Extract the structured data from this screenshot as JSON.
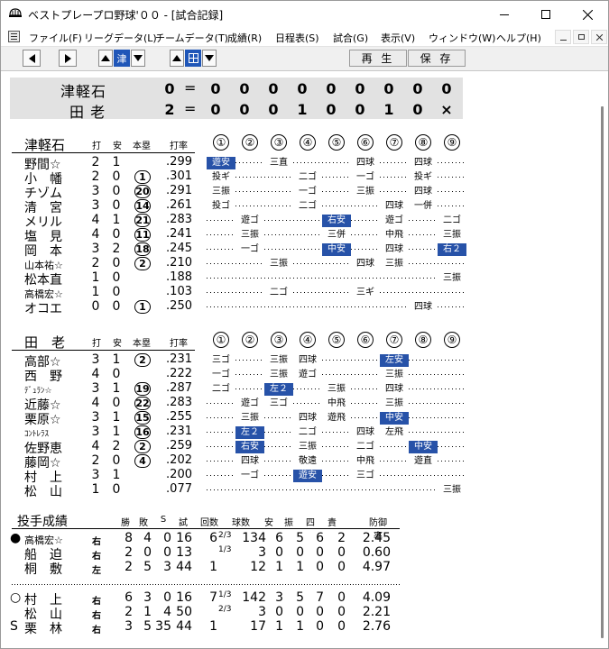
{
  "window": {
    "title": "ベストプレープロ野球'００ - [試合記録]"
  },
  "menu": [
    "ファイル(F)",
    "リーグデータ(L)",
    "チームデータ(T)",
    "成績(R)",
    "日程表(S)",
    "試合(G)",
    "表示(V)",
    "ウィンドウ(W)",
    "ヘルプ(H)"
  ],
  "toolbar": {
    "team_label": "津",
    "play_label": "再 生",
    "save_label": "保 存"
  },
  "score": {
    "away": {
      "name": "津軽石",
      "total": "0",
      "innings": [
        "0",
        "0",
        "0",
        "0",
        "0",
        "0",
        "0",
        "0",
        "0"
      ]
    },
    "home": {
      "name": "田 老",
      "total": "2",
      "innings": [
        "0",
        "0",
        "0",
        "1",
        "0",
        "0",
        "1",
        "0",
        "×"
      ]
    },
    "eq": "="
  },
  "headers": {
    "ab": "打",
    "hit": "安",
    "hr": "本塁",
    "avg": "打率",
    "innings": [
      "①",
      "②",
      "③",
      "④",
      "⑤",
      "⑥",
      "⑦",
      "⑧",
      "⑨"
    ]
  },
  "away_team": {
    "name": "津軽石",
    "batters": [
      {
        "name": "野間☆",
        "ab": "2",
        "hit": "1",
        "hr": "",
        "avg": ".299",
        "size": "n",
        "inn": [
          {
            "t": "遊安",
            "h": true
          },
          {
            "t": ""
          },
          {
            "t": "三直"
          },
          {
            "t": ""
          },
          {
            "t": ""
          },
          {
            "t": "四球"
          },
          {
            "t": ""
          },
          {
            "t": "四球"
          },
          {
            "t": ""
          }
        ]
      },
      {
        "name": "小　幡",
        "ab": "2",
        "hit": "0",
        "hr": "1",
        "avg": ".301",
        "size": "n",
        "inn": [
          {
            "t": "投ギ"
          },
          {
            "t": ""
          },
          {
            "t": ""
          },
          {
            "t": "二ゴ"
          },
          {
            "t": ""
          },
          {
            "t": "一ゴ"
          },
          {
            "t": ""
          },
          {
            "t": "投ギ"
          },
          {
            "t": ""
          }
        ]
      },
      {
        "name": "チゾム",
        "ab": "3",
        "hit": "0",
        "hr": "20",
        "avg": ".291",
        "size": "n",
        "inn": [
          {
            "t": "三振"
          },
          {
            "t": ""
          },
          {
            "t": ""
          },
          {
            "t": "一ゴ"
          },
          {
            "t": ""
          },
          {
            "t": "三振"
          },
          {
            "t": ""
          },
          {
            "t": "四球"
          },
          {
            "t": ""
          }
        ]
      },
      {
        "name": "清　宮",
        "ab": "3",
        "hit": "0",
        "hr": "14",
        "avg": ".261",
        "size": "n",
        "inn": [
          {
            "t": "投ゴ"
          },
          {
            "t": ""
          },
          {
            "t": ""
          },
          {
            "t": "二ゴ"
          },
          {
            "t": ""
          },
          {
            "t": ""
          },
          {
            "t": "四球"
          },
          {
            "t": "一併"
          },
          {
            "t": ""
          }
        ]
      },
      {
        "name": "メリル",
        "ab": "4",
        "hit": "1",
        "hr": "21",
        "avg": ".283",
        "size": "n",
        "inn": [
          {
            "t": ""
          },
          {
            "t": "遊ゴ"
          },
          {
            "t": ""
          },
          {
            "t": ""
          },
          {
            "t": "右安",
            "h": true
          },
          {
            "t": ""
          },
          {
            "t": "遊ゴ"
          },
          {
            "t": ""
          },
          {
            "t": "二ゴ"
          }
        ]
      },
      {
        "name": "塩　見",
        "ab": "4",
        "hit": "0",
        "hr": "11",
        "avg": ".241",
        "size": "n",
        "inn": [
          {
            "t": ""
          },
          {
            "t": "三振"
          },
          {
            "t": ""
          },
          {
            "t": ""
          },
          {
            "t": "三併"
          },
          {
            "t": ""
          },
          {
            "t": "中飛"
          },
          {
            "t": ""
          },
          {
            "t": "三振"
          }
        ]
      },
      {
        "name": "岡　本",
        "ab": "3",
        "hit": "2",
        "hr": "18",
        "avg": ".245",
        "size": "n",
        "inn": [
          {
            "t": ""
          },
          {
            "t": "一ゴ"
          },
          {
            "t": ""
          },
          {
            "t": ""
          },
          {
            "t": "中安",
            "h": true
          },
          {
            "t": ""
          },
          {
            "t": "四球"
          },
          {
            "t": ""
          },
          {
            "t": "右２",
            "h": true
          }
        ]
      },
      {
        "name": "山本祐☆",
        "ab": "2",
        "hit": "0",
        "hr": "2",
        "avg": ".210",
        "size": "s",
        "inn": [
          {
            "t": ""
          },
          {
            "t": ""
          },
          {
            "t": "三振"
          },
          {
            "t": ""
          },
          {
            "t": ""
          },
          {
            "t": "四球"
          },
          {
            "t": "三振"
          },
          {
            "t": ""
          },
          {
            "t": ""
          }
        ]
      },
      {
        "name": "松本直",
        "ab": "1",
        "hit": "0",
        "hr": "",
        "avg": ".188",
        "size": "n",
        "inn": [
          {
            "t": ""
          },
          {
            "t": ""
          },
          {
            "t": ""
          },
          {
            "t": ""
          },
          {
            "t": ""
          },
          {
            "t": ""
          },
          {
            "t": ""
          },
          {
            "t": ""
          },
          {
            "t": "三振"
          }
        ]
      },
      {
        "name": "高橋宏☆",
        "ab": "1",
        "hit": "0",
        "hr": "",
        "avg": ".103",
        "size": "s",
        "inn": [
          {
            "t": ""
          },
          {
            "t": ""
          },
          {
            "t": "二ゴ"
          },
          {
            "t": ""
          },
          {
            "t": ""
          },
          {
            "t": "三ギ"
          },
          {
            "t": ""
          },
          {
            "t": ""
          },
          {
            "t": ""
          }
        ]
      },
      {
        "name": "オコエ",
        "ab": "0",
        "hit": "0",
        "hr": "1",
        "avg": ".250",
        "size": "n",
        "inn": [
          {
            "t": "-"
          },
          {
            "t": "-"
          },
          {
            "t": "-"
          },
          {
            "t": "-"
          },
          {
            "t": "-"
          },
          {
            "t": "-"
          },
          {
            "t": "-"
          },
          {
            "t": "四球"
          },
          {
            "t": "-"
          }
        ]
      }
    ]
  },
  "home_team": {
    "name": "田　老",
    "batters": [
      {
        "name": "高部☆",
        "ab": "3",
        "hit": "1",
        "hr": "2",
        "avg": ".231",
        "size": "n",
        "inn": [
          {
            "t": "三ゴ"
          },
          {
            "t": ""
          },
          {
            "t": "三振"
          },
          {
            "t": "四球"
          },
          {
            "t": ""
          },
          {
            "t": ""
          },
          {
            "t": "左安",
            "h": true
          },
          {
            "t": ""
          },
          {
            "t": ""
          }
        ]
      },
      {
        "name": "西　野",
        "ab": "4",
        "hit": "0",
        "hr": "",
        "avg": ".222",
        "size": "n",
        "inn": [
          {
            "t": "一ゴ"
          },
          {
            "t": ""
          },
          {
            "t": "三振"
          },
          {
            "t": "遊ゴ"
          },
          {
            "t": ""
          },
          {
            "t": ""
          },
          {
            "t": "三振"
          },
          {
            "t": ""
          },
          {
            "t": ""
          }
        ]
      },
      {
        "name": "ﾃﾞｭﾗﾝ☆",
        "ab": "3",
        "hit": "1",
        "hr": "19",
        "avg": ".287",
        "size": "t",
        "inn": [
          {
            "t": "二ゴ"
          },
          {
            "t": ""
          },
          {
            "t": "左２",
            "h": true
          },
          {
            "t": ""
          },
          {
            "t": "三振"
          },
          {
            "t": ""
          },
          {
            "t": "四球"
          },
          {
            "t": ""
          },
          {
            "t": ""
          }
        ]
      },
      {
        "name": "近藤☆",
        "ab": "4",
        "hit": "0",
        "hr": "22",
        "avg": ".283",
        "size": "n",
        "inn": [
          {
            "t": ""
          },
          {
            "t": "遊ゴ"
          },
          {
            "t": "三ゴ"
          },
          {
            "t": ""
          },
          {
            "t": "中飛"
          },
          {
            "t": ""
          },
          {
            "t": "三振"
          },
          {
            "t": ""
          },
          {
            "t": ""
          }
        ]
      },
      {
        "name": "栗原☆",
        "ab": "3",
        "hit": "1",
        "hr": "15",
        "avg": ".255",
        "size": "n",
        "inn": [
          {
            "t": ""
          },
          {
            "t": "三振"
          },
          {
            "t": ""
          },
          {
            "t": "四球"
          },
          {
            "t": "遊飛"
          },
          {
            "t": ""
          },
          {
            "t": "中安",
            "h": true
          },
          {
            "t": ""
          },
          {
            "t": ""
          }
        ]
      },
      {
        "name": "ｺﾝﾄﾚﾗｽ",
        "ab": "3",
        "hit": "1",
        "hr": "16",
        "avg": ".231",
        "size": "t",
        "inn": [
          {
            "t": ""
          },
          {
            "t": "左２",
            "h": true
          },
          {
            "t": ""
          },
          {
            "t": "二ゴ"
          },
          {
            "t": ""
          },
          {
            "t": "四球"
          },
          {
            "t": "左飛"
          },
          {
            "t": ""
          },
          {
            "t": ""
          }
        ]
      },
      {
        "name": "佐野恵",
        "ab": "4",
        "hit": "2",
        "hr": "2",
        "avg": ".259",
        "size": "n",
        "inn": [
          {
            "t": ""
          },
          {
            "t": "右安",
            "h": true
          },
          {
            "t": ""
          },
          {
            "t": "三振"
          },
          {
            "t": ""
          },
          {
            "t": "二ゴ"
          },
          {
            "t": ""
          },
          {
            "t": "中安",
            "h": true
          },
          {
            "t": ""
          }
        ]
      },
      {
        "name": "藤岡☆",
        "ab": "2",
        "hit": "0",
        "hr": "4",
        "avg": ".202",
        "size": "n",
        "inn": [
          {
            "t": ""
          },
          {
            "t": "四球"
          },
          {
            "t": ""
          },
          {
            "t": "敬遠"
          },
          {
            "t": ""
          },
          {
            "t": "中飛"
          },
          {
            "t": ""
          },
          {
            "t": "遊直"
          },
          {
            "t": ""
          }
        ]
      },
      {
        "name": "村　上",
        "ab": "3",
        "hit": "1",
        "hr": "",
        "avg": ".200",
        "size": "n",
        "inn": [
          {
            "t": ""
          },
          {
            "t": "一ゴ"
          },
          {
            "t": ""
          },
          {
            "t": "遊安",
            "h": true
          },
          {
            "t": ""
          },
          {
            "t": "三ゴ"
          },
          {
            "t": ""
          },
          {
            "t": ""
          },
          {
            "t": ""
          }
        ]
      },
      {
        "name": "松　山",
        "ab": "1",
        "hit": "0",
        "hr": "",
        "avg": ".077",
        "size": "n",
        "inn": [
          {
            "t": "-"
          },
          {
            "t": "-"
          },
          {
            "t": "-"
          },
          {
            "t": "-"
          },
          {
            "t": "-"
          },
          {
            "t": "-"
          },
          {
            "t": "-"
          },
          {
            "t": "-"
          },
          {
            "t": "三振"
          }
        ]
      }
    ]
  },
  "pitching": {
    "title": "投手成績",
    "headers": [
      "勝",
      "敗",
      "S",
      "試",
      "回数",
      "球数",
      "安",
      "振",
      "四",
      "責",
      "防御率"
    ],
    "away": [
      {
        "mark": "●",
        "name": "高橋宏☆",
        "hand": "右",
        "w": "8",
        "l": "4",
        "s": "0",
        "g": "16",
        "ip": "6",
        "ipf": "2/3",
        "np": "134",
        "h": "6",
        "k": "5",
        "bb": "6",
        "er": "2",
        "era": "2.45",
        "small": true
      },
      {
        "mark": "",
        "name": "船　迫",
        "hand": "右",
        "w": "2",
        "l": "0",
        "s": "0",
        "g": "13",
        "ip": "",
        "ipf": "1/3",
        "np": "3",
        "h": "0",
        "k": "0",
        "bb": "0",
        "er": "0",
        "era": "0.60"
      },
      {
        "mark": "",
        "name": "桐　敷",
        "hand": "左",
        "w": "2",
        "l": "5",
        "s": "3",
        "g": "44",
        "ip": "1",
        "ipf": "",
        "np": "12",
        "h": "1",
        "k": "1",
        "bb": "0",
        "er": "0",
        "era": "4.97"
      }
    ],
    "home": [
      {
        "mark": "○",
        "name": "村　上",
        "hand": "右",
        "w": "6",
        "l": "3",
        "s": "0",
        "g": "16",
        "ip": "7",
        "ipf": "1/3",
        "np": "142",
        "h": "3",
        "k": "5",
        "bb": "7",
        "er": "0",
        "era": "4.09"
      },
      {
        "mark": "",
        "name": "松　山",
        "hand": "右",
        "w": "2",
        "l": "1",
        "s": "4",
        "g": "50",
        "ip": "",
        "ipf": "2/3",
        "np": "3",
        "h": "0",
        "k": "0",
        "bb": "0",
        "er": "0",
        "era": "2.21"
      },
      {
        "mark": "S",
        "name": "栗　林",
        "hand": "右",
        "w": "3",
        "l": "5",
        "s": "35",
        "g": "44",
        "ip": "1",
        "ipf": "",
        "np": "17",
        "h": "1",
        "k": "1",
        "bb": "0",
        "er": "0",
        "era": "2.76"
      }
    ]
  }
}
